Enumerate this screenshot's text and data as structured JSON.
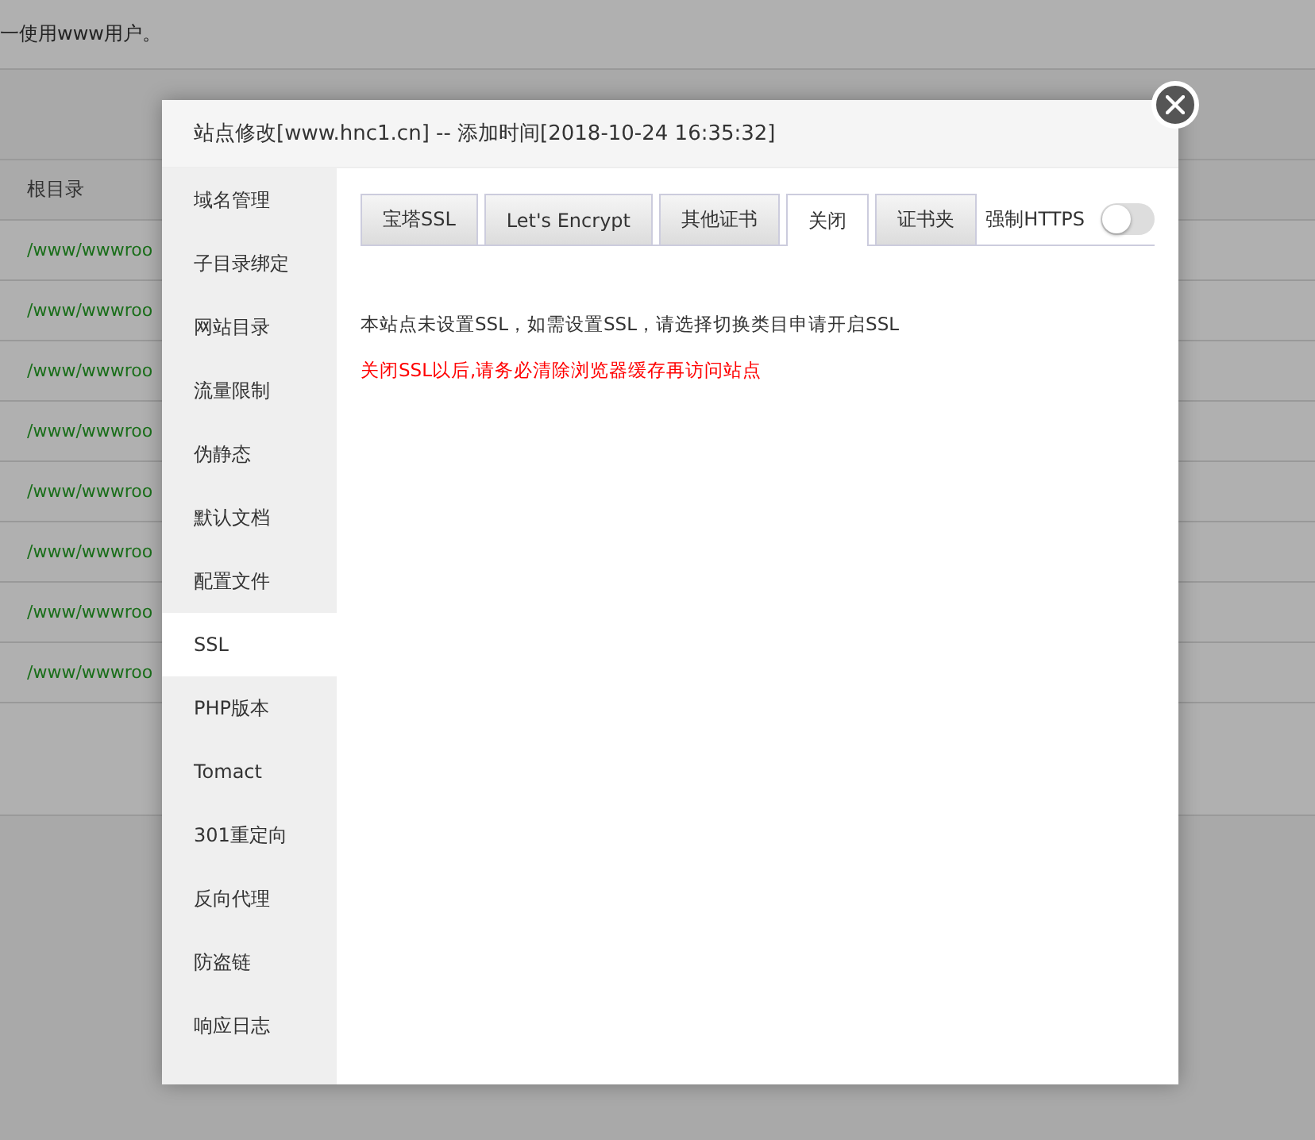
{
  "page": {
    "notice": "一使用www用户。",
    "table": {
      "header": "根目录",
      "rows": [
        "/www/wwwroo",
        "/www/wwwroo",
        "/www/wwwroo",
        "/www/wwwroo",
        "/www/wwwroo",
        "/www/wwwroo",
        "/www/wwwroo",
        "/www/wwwroo"
      ]
    }
  },
  "dialog": {
    "title": "站点修改[www.hnc1.cn] -- 添加时间[2018-10-24 16:35:32]",
    "sidebar": {
      "items": [
        {
          "label": "域名管理",
          "selected": false
        },
        {
          "label": "子目录绑定",
          "selected": false
        },
        {
          "label": "网站目录",
          "selected": false
        },
        {
          "label": "流量限制",
          "selected": false
        },
        {
          "label": "伪静态",
          "selected": false
        },
        {
          "label": "默认文档",
          "selected": false
        },
        {
          "label": "配置文件",
          "selected": false
        },
        {
          "label": "SSL",
          "selected": true
        },
        {
          "label": "PHP版本",
          "selected": false
        },
        {
          "label": "Tomact",
          "selected": false
        },
        {
          "label": "301重定向",
          "selected": false
        },
        {
          "label": "反向代理",
          "selected": false
        },
        {
          "label": "防盗链",
          "selected": false
        },
        {
          "label": "响应日志",
          "selected": false
        }
      ]
    },
    "tabs": [
      {
        "label": "宝塔SSL",
        "selected": false
      },
      {
        "label": "Let's Encrypt",
        "selected": false
      },
      {
        "label": "其他证书",
        "selected": false
      },
      {
        "label": "关闭",
        "selected": true
      },
      {
        "label": "证书夹",
        "selected": false
      }
    ],
    "force_https": {
      "label": "强制HTTPS",
      "on": false
    },
    "messages": [
      {
        "text": "本站点未设置SSL，如需设置SSL，请选择切换类目申请开启SSL",
        "kind": "info"
      },
      {
        "text": "关闭SSL以后,请务必清除浏览器缓存再访问站点",
        "kind": "warning"
      }
    ]
  }
}
